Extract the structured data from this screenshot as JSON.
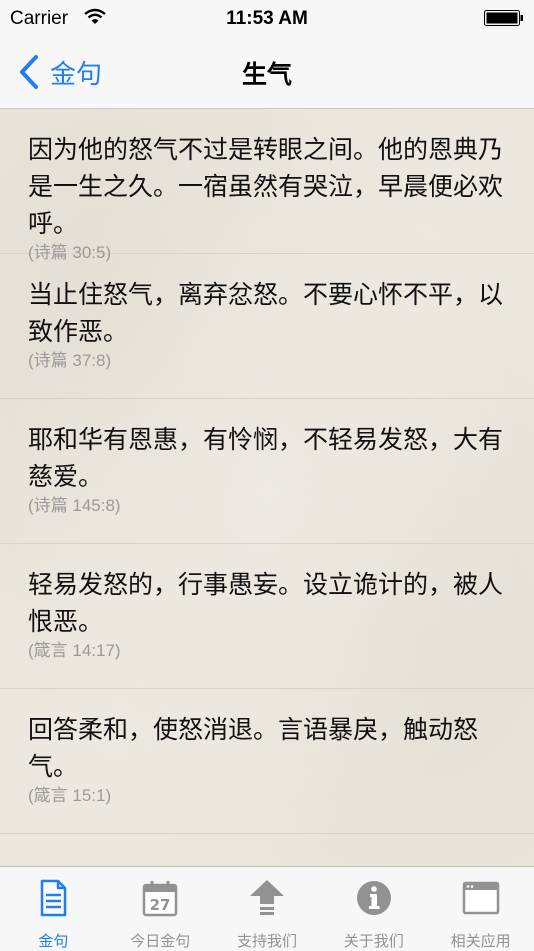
{
  "status_bar": {
    "carrier": "Carrier",
    "time": "11:53 AM"
  },
  "nav": {
    "back_label": "金句",
    "title": "生气"
  },
  "verses": [
    {
      "text": "因为他的怒气不过是转眼之间。他的恩典乃是一生之久。一宿虽然有哭泣，早晨便必欢呼。",
      "ref": "(诗篇 30:5)"
    },
    {
      "text": "当止住怒气，离弃忿怒。不要心怀不平，以致作恶。",
      "ref": "(诗篇 37:8)"
    },
    {
      "text": "耶和华有恩惠，有怜悯，不轻易发怒，大有慈爱。",
      "ref": "(诗篇 145:8)"
    },
    {
      "text": "轻易发怒的，行事愚妄。设立诡计的，被人恨恶。",
      "ref": "(箴言 14:17)"
    },
    {
      "text": "回答柔和，使怒消退。言语暴戾，触动怒气。",
      "ref": "(箴言 15:1)"
    }
  ],
  "tabs": [
    {
      "label": "金句",
      "icon": "document-icon"
    },
    {
      "label": "今日金句",
      "icon": "calendar-icon",
      "calendar_day": "27"
    },
    {
      "label": "支持我们",
      "icon": "upload-arrow-icon"
    },
    {
      "label": "关于我们",
      "icon": "info-icon"
    },
    {
      "label": "相关应用",
      "icon": "window-icon"
    }
  ],
  "colors": {
    "accent": "#1f7ff1",
    "inactive": "#929292"
  }
}
